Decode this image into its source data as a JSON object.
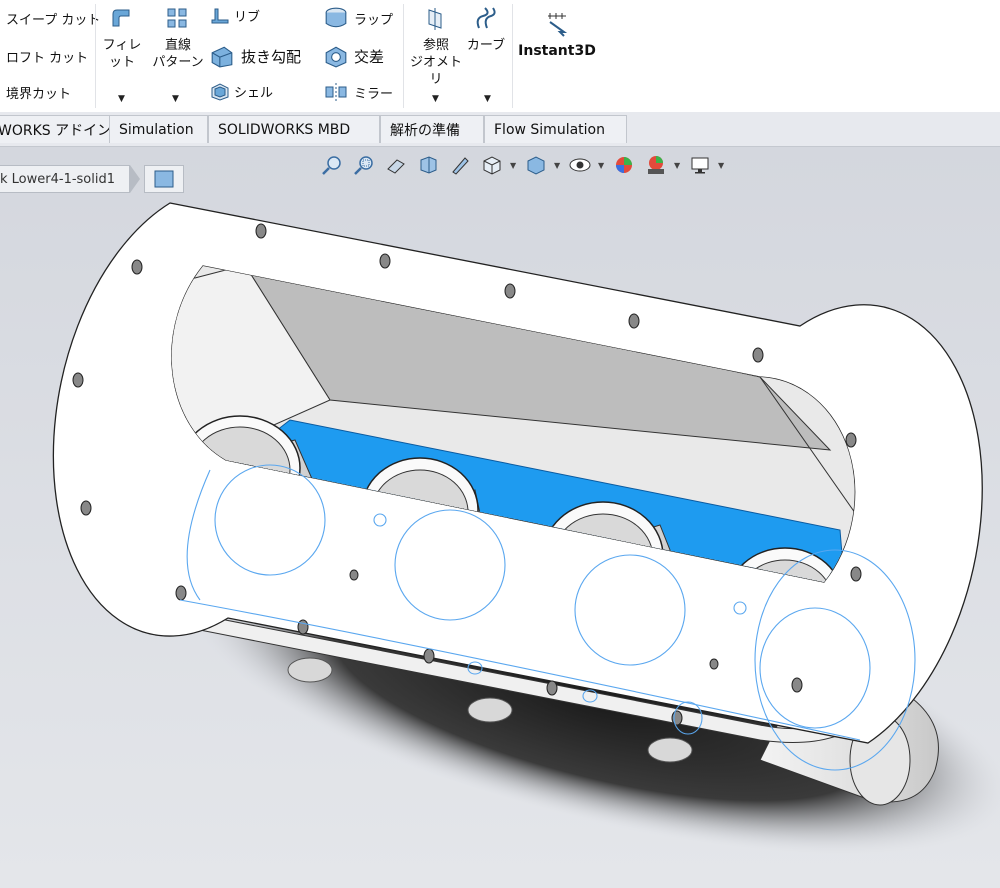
{
  "ribbon": {
    "left_items": [
      "スイープ カット",
      "ロフト カット",
      "境界カット"
    ],
    "fillet": "フィレット",
    "pattern_1": "直線",
    "pattern_2": "パターン",
    "middle_items": [
      "リブ",
      "抜き勾配",
      "シェル"
    ],
    "right_items": [
      "ラップ",
      "交差",
      "ミラー"
    ],
    "ref_geom_1": "参照",
    "ref_geom_2": "ジオメトリ",
    "curves": "カーブ",
    "instant3d": "Instant3D"
  },
  "tabs": [
    "WORKS アドイン",
    "Simulation",
    "SOLIDWORKS MBD",
    "解析の準備",
    "Flow Simulation"
  ],
  "breadcrumb": {
    "label": "k Lower4-1-solid1"
  },
  "hud_icons": [
    "zoom-to-fit-icon",
    "zoom-to-area-icon",
    "previous-view-icon",
    "section-view-icon",
    "dynamic-annotation-icon",
    "view-orientation-icon",
    "display-style-icon",
    "hide-show-icon",
    "edit-appearance-icon",
    "apply-scene-icon",
    "view-settings-icon"
  ],
  "colors": {
    "selected_face": "#1e9bf0",
    "ribbon_bg": "#ffffff",
    "tab_bg": "#eef0f4",
    "viewport_bg": "#d4d7de"
  }
}
